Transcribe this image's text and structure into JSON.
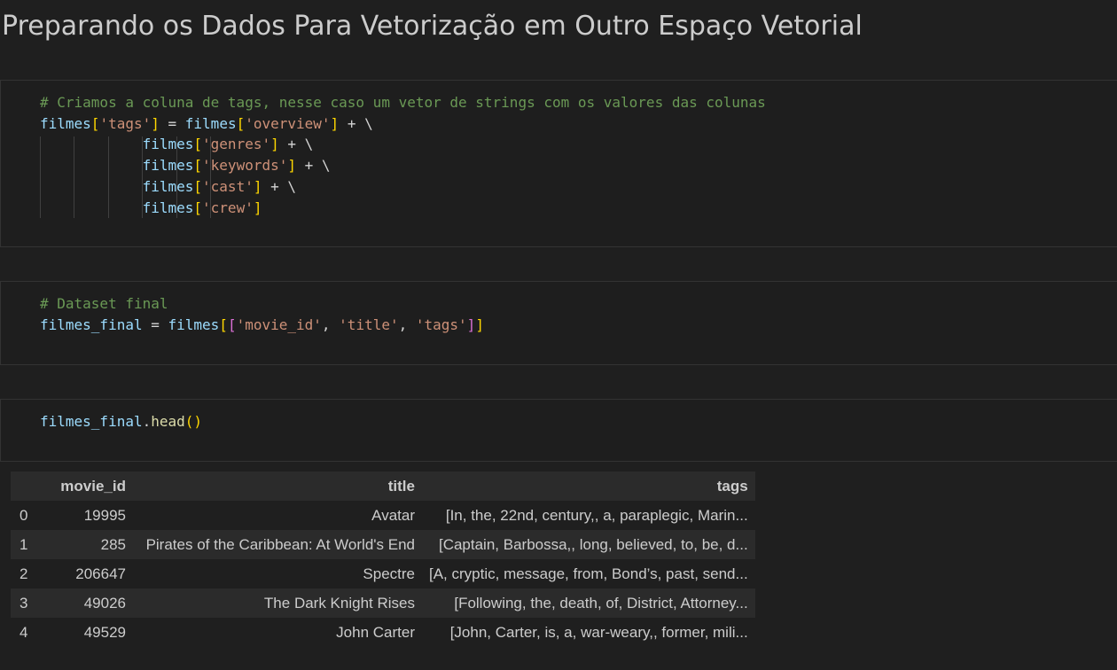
{
  "heading": "Preparando os Dados Para Vetorização em Outro Espaço Vetorial",
  "cell1": {
    "comment": "# Criamos a coluna de tags, nesse caso um vetor de strings com os valores das colunas",
    "var": "filmes",
    "tags_key": "'tags'",
    "overview_key": "'overview'",
    "genres_key": "'genres'",
    "keywords_key": "'keywords'",
    "cast_key": "'cast'",
    "crew_key": "'crew'"
  },
  "cell2": {
    "comment": "# Dataset final",
    "target": "filmes_final",
    "source": "filmes",
    "cols": [
      "'movie_id'",
      "'title'",
      "'tags'"
    ]
  },
  "cell3": {
    "object": "filmes_final",
    "method": "head"
  },
  "table": {
    "columns": [
      "movie_id",
      "title",
      "tags"
    ],
    "rows": [
      {
        "index": "0",
        "movie_id": "19995",
        "title": "Avatar",
        "tags": "[In, the, 22nd, century,, a, paraplegic, Marin..."
      },
      {
        "index": "1",
        "movie_id": "285",
        "title": "Pirates of the Caribbean: At World's End",
        "tags": "[Captain, Barbossa,, long, believed, to, be, d..."
      },
      {
        "index": "2",
        "movie_id": "206647",
        "title": "Spectre",
        "tags": "[A, cryptic, message, from, Bond’s, past, send..."
      },
      {
        "index": "3",
        "movie_id": "49026",
        "title": "The Dark Knight Rises",
        "tags": "[Following, the, death, of, District, Attorney..."
      },
      {
        "index": "4",
        "movie_id": "49529",
        "title": "John Carter",
        "tags": "[John, Carter, is, a, war-weary,, former, mili..."
      }
    ]
  },
  "colors": {
    "background": "#1f1f1f",
    "comment": "#6a9955",
    "variable": "#9cdcfe",
    "string": "#ce9178",
    "bracket_level1": "#ffd700",
    "bracket_level2": "#da70d6",
    "function": "#dcdcaa"
  }
}
